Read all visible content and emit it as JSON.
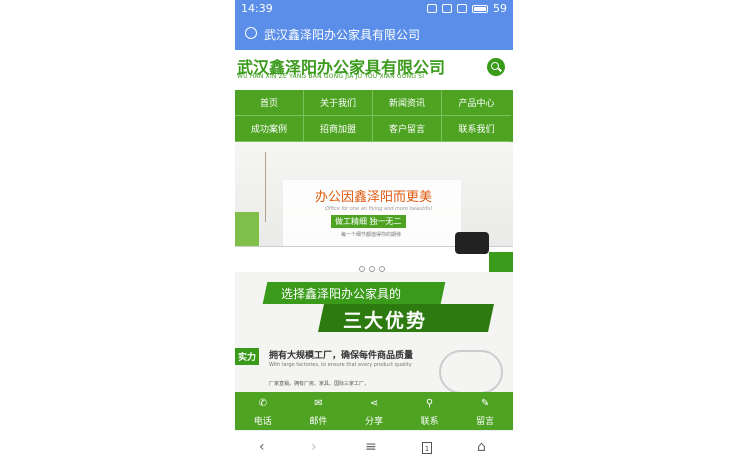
{
  "statusbar": {
    "time": "14:39",
    "battery": "59"
  },
  "urlbar": {
    "title": "武汉鑫泽阳办公家具有限公司"
  },
  "logo": {
    "cn": "武汉鑫泽阳办公家具有限公司",
    "en": "WU HAN XIN ZE YANG BAN GONG JIA JU YOU XIAN GONG SI"
  },
  "nav": {
    "items": [
      "首页",
      "关于我们",
      "新闻资讯",
      "产品中心",
      "成功案例",
      "招商加盟",
      "客户留言",
      "联系我们"
    ]
  },
  "banner": {
    "headline": "办公因鑫泽阳而更美",
    "subtitle": "Office for one an flying and more beautiful",
    "tag": "做工精细 独一无二",
    "tag_sub": "每一个细节都值得你的期待"
  },
  "advantages": {
    "ribbon1": "选择鑫泽阳办公家具的",
    "ribbon2": "三大优势",
    "badge": "实力",
    "point_title": "拥有大规模工厂，确保每件商品质量",
    "point_en": "With large factories, to ensure that every product quality",
    "detail": "厂家直销，拥有厂房、家具、国际三家工厂，"
  },
  "bottombar": {
    "items": [
      {
        "icon": "phone-icon",
        "label": "电话"
      },
      {
        "icon": "mail-icon",
        "label": "邮件"
      },
      {
        "icon": "share-icon",
        "label": "分享"
      },
      {
        "icon": "location-icon",
        "label": "联系"
      },
      {
        "icon": "edit-icon",
        "label": "留言"
      }
    ]
  },
  "sysnav": {
    "tabs_count": "1"
  },
  "colors": {
    "brand_green": "#4ea323",
    "dark_green": "#2c7a10",
    "browser_blue": "#5a8ee8",
    "accent_orange": "#e05a10"
  }
}
